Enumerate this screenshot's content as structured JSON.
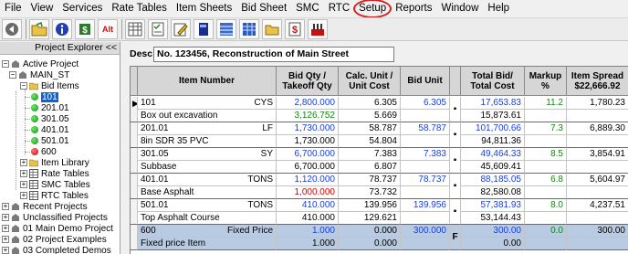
{
  "menu": [
    "File",
    "View",
    "Services",
    "Rate Tables",
    "Item Sheets",
    "Bid Sheet",
    "SMC",
    "RTC",
    "Setup",
    "Reports",
    "Window",
    "Help"
  ],
  "menu_highlighted": "Setup",
  "toolbar": {
    "icons": [
      "back-arrow-icon",
      "open-folder-icon",
      "info-icon",
      "money-icon",
      "alt-icon",
      "grid-icon",
      "checklist-icon",
      "edit-icon",
      "book-icon",
      "table-icon",
      "spreadsheet-icon",
      "folder-icon",
      "dollar-sheet-icon",
      "tools-icon"
    ],
    "alt_label": "Alt"
  },
  "explorer": {
    "header": "Project Explorer <<",
    "tree": {
      "active_project": "Active Project",
      "main_st": "MAIN_ST",
      "bid_items": "Bid Items",
      "bid_item_codes": [
        {
          "label": "101",
          "color": "green",
          "selected": true
        },
        {
          "label": "201.01",
          "color": "green",
          "selected": false
        },
        {
          "label": "301.05",
          "color": "green",
          "selected": false
        },
        {
          "label": "401.01",
          "color": "green",
          "selected": false
        },
        {
          "label": "501.01",
          "color": "green",
          "selected": false
        },
        {
          "label": "600",
          "color": "red",
          "selected": false
        }
      ],
      "sub_nodes": [
        "Item Library",
        "Rate Tables",
        "SMC Tables",
        "RTC Tables"
      ],
      "top_nodes": [
        "Recent Projects",
        "Unclassified Projects",
        "01 Main Demo Project",
        "02 Project Examples",
        "03 Completed Demos"
      ]
    }
  },
  "desc": {
    "label": "Desc",
    "value": "No. 123456, Reconstruction of Main Street"
  },
  "grid": {
    "headers": {
      "item_number": "Item Number",
      "bid_qty_1": "Bid Qty /",
      "bid_qty_2": "Takeoff Qty",
      "calc_unit_1": "Calc. Unit /",
      "calc_unit_2": "Unit Cost",
      "bid_unit": "Bid Unit",
      "total_bid_1": "Total Bid/",
      "total_bid_2": "Total Cost",
      "markup": "Markup %",
      "item_spread_1": "Item Spread",
      "item_spread_2": "$22,666.92"
    },
    "rows": [
      {
        "code": "101",
        "unit": "CYS",
        "desc": "Box out excavation",
        "bid_qty": "2,800.000",
        "takeoff_qty": "3,126.752",
        "takeoff_color": "green",
        "calc_unit": "6.305",
        "unit_cost": "5.669",
        "bid_unit": "6.305",
        "flag": "▪",
        "total_bid": "17,653.83",
        "total_cost": "15,873.61",
        "markup": "11.2",
        "spread": "1,780.23",
        "current": true
      },
      {
        "code": "201.01",
        "unit": "LF",
        "desc": "8in SDR 35 PVC",
        "bid_qty": "1,730.000",
        "takeoff_qty": "1,730.000",
        "takeoff_color": "black",
        "calc_unit": "58.787",
        "unit_cost": "54.804",
        "bid_unit": "58.787",
        "flag": "▪",
        "total_bid": "101,700.66",
        "total_cost": "94,811.36",
        "markup": "7.3",
        "spread": "6,889.30",
        "current": false
      },
      {
        "code": "301.05",
        "unit": "SY",
        "desc": "Subbase",
        "bid_qty": "6,700.000",
        "takeoff_qty": "6,700.000",
        "takeoff_color": "black",
        "calc_unit": "7.383",
        "unit_cost": "6.807",
        "bid_unit": "7.383",
        "flag": "▪",
        "total_bid": "49,464.33",
        "total_cost": "45,609.41",
        "markup": "8.5",
        "spread": "3,854.91",
        "current": false
      },
      {
        "code": "401.01",
        "unit": "TONS",
        "desc": "Base Asphalt",
        "bid_qty": "1,120.000",
        "takeoff_qty": "1,000.000",
        "takeoff_color": "red",
        "calc_unit": "78.737",
        "unit_cost": "73.732",
        "bid_unit": "78.737",
        "flag": "▪",
        "total_bid": "88,185.05",
        "total_cost": "82,580.08",
        "markup": "6.8",
        "spread": "5,604.97",
        "current": false
      },
      {
        "code": "501.01",
        "unit": "TONS",
        "desc": "Top Asphalt Course",
        "bid_qty": "410.000",
        "takeoff_qty": "410.000",
        "takeoff_color": "black",
        "calc_unit": "139.956",
        "unit_cost": "129.621",
        "bid_unit": "139.956",
        "flag": "▪",
        "total_bid": "57,381.93",
        "total_cost": "53,144.43",
        "markup": "8.0",
        "spread": "4,237.51",
        "current": false
      },
      {
        "code": "600",
        "unit": "Fixed Price",
        "desc": "Fixed price Item",
        "bid_qty": "1.000",
        "takeoff_qty": "1.000",
        "takeoff_color": "black",
        "calc_unit": "0.000",
        "unit_cost": "0.000",
        "bid_unit": "300.000",
        "flag": "F",
        "total_bid": "300.00",
        "total_cost": "0.00",
        "markup": "0.0",
        "spread": "300.00",
        "current": false,
        "fixed": true
      }
    ]
  }
}
